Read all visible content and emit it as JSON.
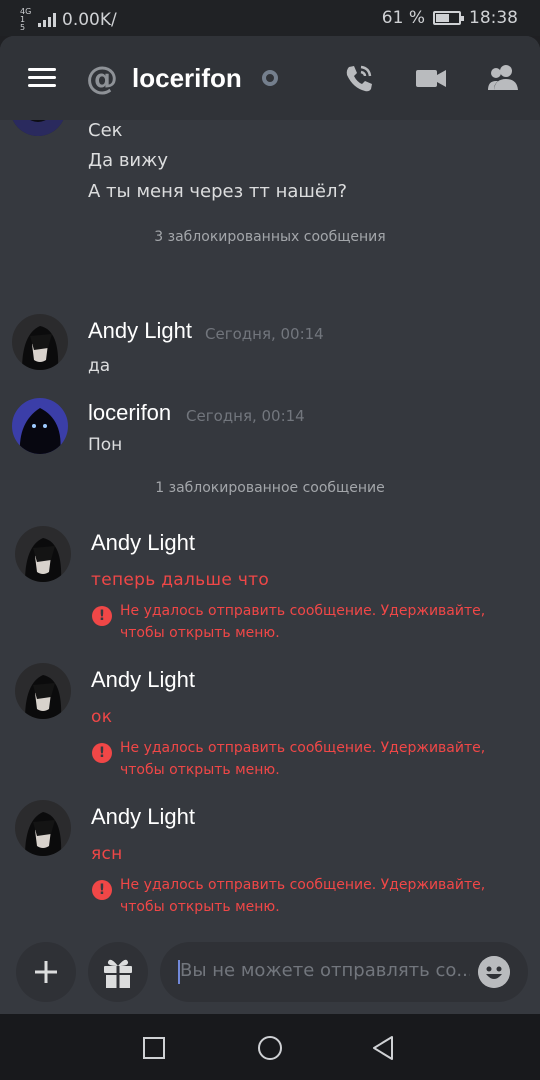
{
  "status_bar": {
    "network_type": "4G",
    "network_sub": "1 5",
    "data_speed": "0.00K/",
    "battery_text": "61 %",
    "battery_level": 0.61,
    "time": "18:38"
  },
  "header": {
    "menu_icon": "hamburger-icon",
    "at_icon": "at-icon",
    "title": "locerifon",
    "status": "offline",
    "icons": [
      "phone-call-icon",
      "video-camera-icon",
      "members-icon"
    ]
  },
  "messages": {
    "top_lines": [
      "Сек",
      "Да вижу",
      "А ты меня через тт нашёл?"
    ],
    "blocked_1": "3 заблокированных сообщения",
    "group_1": {
      "author": "Andy Light",
      "time": "Сегодня, 00:14",
      "text": "да"
    },
    "group_2": {
      "author": "locerifon",
      "time": "Сегодня, 00:14",
      "text": "Пон"
    },
    "blocked_2": "1 заблокированное сообщение",
    "failed": [
      {
        "author": "Andy Light",
        "text": "теперь дальше что",
        "error": "Не удалось отправить сообщение. Удерживайте, чтобы открыть меню."
      },
      {
        "author": "Andy Light",
        "text": "ок",
        "error": "Не удалось отправить сообщение. Удерживайте, чтобы открыть меню."
      },
      {
        "author": "Andy Light",
        "text": "ясн",
        "error": "Не удалось отправить сообщение. Удерживайте, чтобы открыть меню."
      }
    ]
  },
  "composer": {
    "plus_icon": "plus-icon",
    "gift_icon": "gift-icon",
    "placeholder": "Вы не можете отправлять со...",
    "emoji_icon": "emoji-icon"
  },
  "navbar": {
    "icons": [
      "recents-square-icon",
      "home-circle-icon",
      "back-triangle-icon"
    ]
  },
  "colors": {
    "background": "#36393f",
    "header": "#303338",
    "error": "#f04747",
    "accent": "#7289da"
  }
}
